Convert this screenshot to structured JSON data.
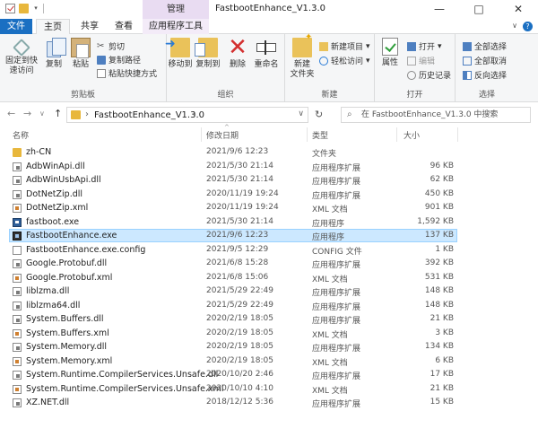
{
  "window": {
    "title": "FastbootEnhance_V1.3.0",
    "minimize_glyph": "—",
    "maximize_glyph": "□",
    "close_glyph": "✕"
  },
  "tabs": {
    "manage_label": "管理",
    "file": "文件",
    "home": "主页",
    "share": "共享",
    "view": "查看",
    "app_tools": "应用程序工具",
    "collapse_glyph": "∨",
    "help_glyph": "?"
  },
  "ribbon": {
    "clipboard": {
      "label": "剪贴板",
      "pin_line1": "固定到快",
      "pin_line2": "速访问",
      "copy": "复制",
      "paste": "粘贴",
      "cut": "剪切",
      "copy_path": "复制路径",
      "paste_shortcut": "粘贴快捷方式"
    },
    "organize": {
      "label": "组织",
      "move_to": "移动到",
      "copy_to": "复制到",
      "delete": "删除",
      "rename": "重命名"
    },
    "new": {
      "label": "新建",
      "new_folder_line1": "新建",
      "new_folder_line2": "文件夹",
      "new_item": "新建项目",
      "easy_access": "轻松访问"
    },
    "open": {
      "label": "打开",
      "properties": "属性",
      "open": "打开",
      "edit": "编辑",
      "history": "历史记录"
    },
    "select": {
      "label": "选择",
      "select_all": "全部选择",
      "select_none": "全部取消",
      "invert": "反向选择"
    }
  },
  "address": {
    "path": "FastbootEnhance_V1.3.0",
    "search_placeholder": "在 FastbootEnhance_V1.3.0 中搜索"
  },
  "columns": {
    "name": "名称",
    "date": "修改日期",
    "type": "类型",
    "size": "大小"
  },
  "files": [
    {
      "name": "zh-CN",
      "date": "2021/9/6 12:23",
      "type": "文件夹",
      "size": "",
      "icon": "folder"
    },
    {
      "name": "AdbWinApi.dll",
      "date": "2021/5/30 21:14",
      "type": "应用程序扩展",
      "size": "96 KB",
      "icon": "dll"
    },
    {
      "name": "AdbWinUsbApi.dll",
      "date": "2021/5/30 21:14",
      "type": "应用程序扩展",
      "size": "62 KB",
      "icon": "dll"
    },
    {
      "name": "DotNetZip.dll",
      "date": "2020/11/19 19:24",
      "type": "应用程序扩展",
      "size": "450 KB",
      "icon": "dll"
    },
    {
      "name": "DotNetZip.xml",
      "date": "2020/11/19 19:24",
      "type": "XML 文档",
      "size": "901 KB",
      "icon": "xml"
    },
    {
      "name": "fastboot.exe",
      "date": "2021/5/30 21:14",
      "type": "应用程序",
      "size": "1,592 KB",
      "icon": "exe"
    },
    {
      "name": "FastbootEnhance.exe",
      "date": "2021/9/6 12:23",
      "type": "应用程序",
      "size": "137 KB",
      "icon": "app"
    },
    {
      "name": "FastbootEnhance.exe.config",
      "date": "2021/9/5 12:29",
      "type": "CONFIG 文件",
      "size": "1 KB",
      "icon": "config"
    },
    {
      "name": "Google.Protobuf.dll",
      "date": "2021/6/8 15:28",
      "type": "应用程序扩展",
      "size": "392 KB",
      "icon": "dll"
    },
    {
      "name": "Google.Protobuf.xml",
      "date": "2021/6/8 15:06",
      "type": "XML 文档",
      "size": "531 KB",
      "icon": "xml"
    },
    {
      "name": "liblzma.dll",
      "date": "2021/5/29 22:49",
      "type": "应用程序扩展",
      "size": "148 KB",
      "icon": "dll"
    },
    {
      "name": "liblzma64.dll",
      "date": "2021/5/29 22:49",
      "type": "应用程序扩展",
      "size": "148 KB",
      "icon": "dll"
    },
    {
      "name": "System.Buffers.dll",
      "date": "2020/2/19 18:05",
      "type": "应用程序扩展",
      "size": "21 KB",
      "icon": "dll"
    },
    {
      "name": "System.Buffers.xml",
      "date": "2020/2/19 18:05",
      "type": "XML 文档",
      "size": "3 KB",
      "icon": "xml"
    },
    {
      "name": "System.Memory.dll",
      "date": "2020/2/19 18:05",
      "type": "应用程序扩展",
      "size": "134 KB",
      "icon": "dll"
    },
    {
      "name": "System.Memory.xml",
      "date": "2020/2/19 18:05",
      "type": "XML 文档",
      "size": "6 KB",
      "icon": "xml"
    },
    {
      "name": "System.Runtime.CompilerServices.Unsafe.dll",
      "date": "2020/10/20 2:46",
      "type": "应用程序扩展",
      "size": "17 KB",
      "icon": "dll"
    },
    {
      "name": "System.Runtime.CompilerServices.Unsafe.xml",
      "date": "2020/10/10 4:10",
      "type": "XML 文档",
      "size": "21 KB",
      "icon": "xml"
    },
    {
      "name": "XZ.NET.dll",
      "date": "2018/12/12 5:36",
      "type": "应用程序扩展",
      "size": "15 KB",
      "icon": "dll"
    }
  ],
  "selected_file": "FastbootEnhance.exe",
  "colors": {
    "accent": "#1a6fc2",
    "manage_tab": "#e9dcf2",
    "selection": "#cce8ff",
    "selection_border": "#99d1ff",
    "folder": "#e8b73c"
  }
}
